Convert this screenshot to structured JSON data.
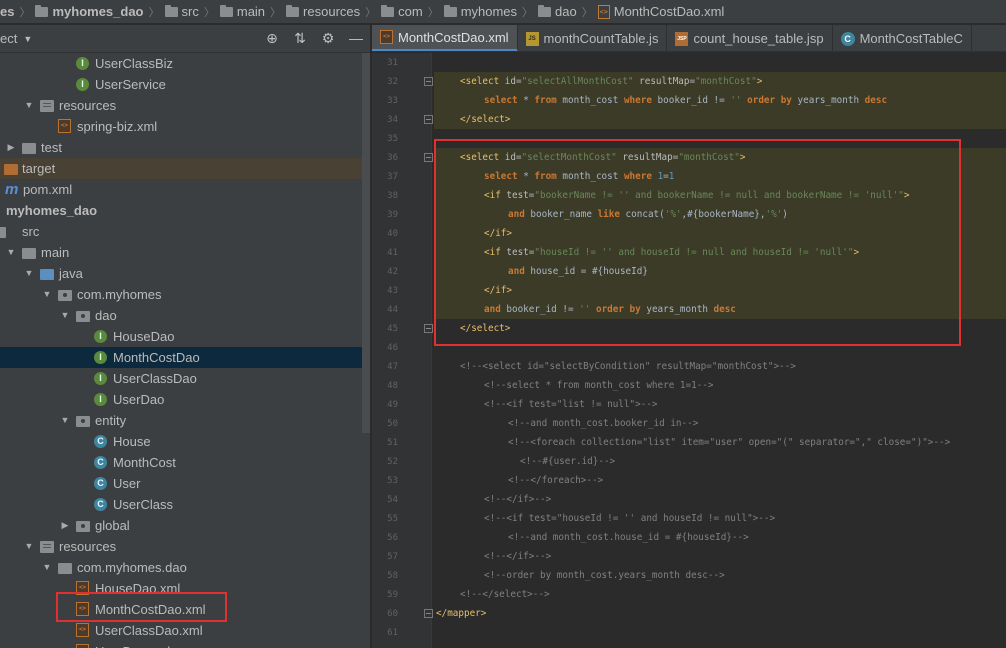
{
  "breadcrumb": [
    "es",
    "myhomes_dao",
    "src",
    "main",
    "resources",
    "com",
    "myhomes",
    "dao",
    "MonthCostDao.xml"
  ],
  "project_panel": {
    "title": "ect",
    "tree": [
      {
        "label": "UserClassBiz",
        "icon": "interface-icon",
        "depth": 4
      },
      {
        "label": "UserService",
        "icon": "interface-icon",
        "depth": 4
      },
      {
        "label": "resources",
        "icon": "resources-folder-icon",
        "depth": 2,
        "arrow": "down"
      },
      {
        "label": "spring-biz.xml",
        "icon": "xml-file-icon",
        "depth": 3
      },
      {
        "label": "test",
        "icon": "folder-icon",
        "depth": 1,
        "arrow": "right"
      },
      {
        "label": "target",
        "icon": "folder-orange-icon",
        "depth": 0,
        "arrow": "",
        "highlight": "target"
      },
      {
        "label": "pom.xml",
        "icon": "maven-icon",
        "depth": 0
      },
      {
        "label": "myhomes_dao",
        "icon": "",
        "depth": 0,
        "bold": true
      },
      {
        "label": "src",
        "icon": "folder-icon",
        "depth": 0
      },
      {
        "label": "main",
        "icon": "folder-icon",
        "depth": 1,
        "arrow": "down"
      },
      {
        "label": "java",
        "icon": "folder-blue-icon",
        "depth": 2,
        "arrow": "down"
      },
      {
        "label": "com.myhomes",
        "icon": "package-icon",
        "depth": 3,
        "arrow": "down"
      },
      {
        "label": "dao",
        "icon": "package-icon",
        "depth": 4,
        "arrow": "down"
      },
      {
        "label": "HouseDao",
        "icon": "interface-icon",
        "depth": 5
      },
      {
        "label": "MonthCostDao",
        "icon": "interface-icon",
        "depth": 5,
        "selected": true
      },
      {
        "label": "UserClassDao",
        "icon": "interface-icon",
        "depth": 5
      },
      {
        "label": "UserDao",
        "icon": "interface-icon",
        "depth": 5
      },
      {
        "label": "entity",
        "icon": "package-icon",
        "depth": 4,
        "arrow": "down"
      },
      {
        "label": "House",
        "icon": "class-icon",
        "depth": 5
      },
      {
        "label": "MonthCost",
        "icon": "class-icon",
        "depth": 5
      },
      {
        "label": "User",
        "icon": "class-icon",
        "depth": 5
      },
      {
        "label": "UserClass",
        "icon": "class-icon",
        "depth": 5
      },
      {
        "label": "global",
        "icon": "package-icon",
        "depth": 4,
        "arrow": "right"
      },
      {
        "label": "resources",
        "icon": "resources-folder-icon",
        "depth": 2,
        "arrow": "down"
      },
      {
        "label": "com.myhomes.dao",
        "icon": "folder-icon",
        "depth": 3,
        "arrow": "down"
      },
      {
        "label": "HouseDao.xml",
        "icon": "xml-file-icon",
        "depth": 4
      },
      {
        "label": "MonthCostDao.xml",
        "icon": "xml-file-icon",
        "depth": 4,
        "boxed": true
      },
      {
        "label": "UserClassDao.xml",
        "icon": "xml-file-icon",
        "depth": 4
      },
      {
        "label": "UserDao.xml",
        "icon": "xml-file-icon",
        "depth": 4
      }
    ]
  },
  "tabs": [
    {
      "label": "MonthCostDao.xml",
      "icon": "xml",
      "active": true
    },
    {
      "label": "monthCountTable.js",
      "icon": "js"
    },
    {
      "label": "count_house_table.jsp",
      "icon": "jsp"
    },
    {
      "label": "MonthCostTableC",
      "icon": "class"
    }
  ],
  "editor": {
    "lines": [
      {
        "n": "31",
        "segs": []
      },
      {
        "n": "32",
        "indent": 2,
        "segs": [
          [
            "t",
            "<select "
          ],
          [
            "an",
            "id="
          ],
          [
            "av",
            "\"selectAllMonthCost\" "
          ],
          [
            "an",
            "resultMap="
          ],
          [
            "av",
            "\"monthCost\""
          ],
          [
            "t",
            ">"
          ]
        ]
      },
      {
        "n": "33",
        "indent": 4,
        "segs": [
          [
            "kw",
            "select"
          ],
          [
            "pl",
            " * "
          ],
          [
            "kw",
            "from"
          ],
          [
            "pl",
            " month_cost "
          ],
          [
            "kw",
            "where"
          ],
          [
            "pl",
            " booker_id != "
          ],
          [
            "str",
            "'' "
          ],
          [
            "kw",
            "order by"
          ],
          [
            "pl",
            " years_month "
          ],
          [
            "kw",
            "desc"
          ]
        ]
      },
      {
        "n": "34",
        "indent": 2,
        "segs": [
          [
            "t",
            "</select>"
          ]
        ]
      },
      {
        "n": "35",
        "segs": []
      },
      {
        "n": "36",
        "indent": 2,
        "segs": [
          [
            "t",
            "<select "
          ],
          [
            "an",
            "id="
          ],
          [
            "av",
            "\"selectMonthCost\" "
          ],
          [
            "an",
            "resultMap="
          ],
          [
            "av",
            "\"monthCost\""
          ],
          [
            "t",
            ">"
          ]
        ]
      },
      {
        "n": "37",
        "indent": 4,
        "segs": [
          [
            "kw",
            "select"
          ],
          [
            "pl",
            " * "
          ],
          [
            "kw",
            "from"
          ],
          [
            "pl",
            " month_cost "
          ],
          [
            "kw",
            "where"
          ],
          [
            "pl",
            " "
          ],
          [
            "num",
            "1"
          ],
          [
            "pl",
            "="
          ],
          [
            "num",
            "1"
          ]
        ]
      },
      {
        "n": "38",
        "indent": 4,
        "segs": [
          [
            "t",
            "<if "
          ],
          [
            "an",
            "test="
          ],
          [
            "av",
            "\"bookerName != '' and bookerName != null and bookerName != 'null'\""
          ],
          [
            "t",
            ">"
          ]
        ]
      },
      {
        "n": "39",
        "indent": 6,
        "segs": [
          [
            "kw",
            "and"
          ],
          [
            "pl",
            " booker_name "
          ],
          [
            "kw",
            "like"
          ],
          [
            "pl",
            " concat("
          ],
          [
            "str",
            "'%'"
          ],
          [
            "pl",
            ",#{bookerName},"
          ],
          [
            "str",
            "'%'"
          ],
          [
            "pl",
            ")"
          ]
        ]
      },
      {
        "n": "40",
        "indent": 4,
        "segs": [
          [
            "t",
            "</if>"
          ]
        ]
      },
      {
        "n": "41",
        "indent": 4,
        "segs": [
          [
            "t",
            "<if "
          ],
          [
            "an",
            "test="
          ],
          [
            "av",
            "\"houseId != '' and houseId != null and houseId != 'null'\""
          ],
          [
            "t",
            ">"
          ]
        ]
      },
      {
        "n": "42",
        "indent": 6,
        "segs": [
          [
            "kw",
            "and"
          ],
          [
            "pl",
            " house_id = #{houseId}"
          ]
        ]
      },
      {
        "n": "43",
        "indent": 4,
        "segs": [
          [
            "t",
            "</if>"
          ]
        ]
      },
      {
        "n": "44",
        "indent": 4,
        "segs": [
          [
            "kw",
            "and"
          ],
          [
            "pl",
            " booker_id != "
          ],
          [
            "str",
            "'' "
          ],
          [
            "kw",
            "order by"
          ],
          [
            "pl",
            " years_month "
          ],
          [
            "kw",
            "desc"
          ]
        ]
      },
      {
        "n": "45",
        "indent": 2,
        "segs": [
          [
            "t",
            "</select>"
          ]
        ]
      },
      {
        "n": "46",
        "segs": []
      },
      {
        "n": "47",
        "indent": 2,
        "segs": [
          [
            "cm",
            "<!--<select id=\"selectByCondition\" resultMap=\"monthCost\">-->"
          ]
        ]
      },
      {
        "n": "48",
        "indent": 4,
        "segs": [
          [
            "cm",
            "<!--select * from month_cost where 1=1-->"
          ]
        ]
      },
      {
        "n": "49",
        "indent": 4,
        "segs": [
          [
            "cm",
            "<!--<if test=\"list != null\">-->"
          ]
        ]
      },
      {
        "n": "50",
        "indent": 6,
        "segs": [
          [
            "cm",
            "<!--and month_cost.booker_id in-->"
          ]
        ]
      },
      {
        "n": "51",
        "indent": 6,
        "segs": [
          [
            "cm",
            "<!--<foreach collection=\"list\" item=\"user\" open=\"(\" separator=\",\" close=\")\">-->"
          ]
        ]
      },
      {
        "n": "52",
        "indent": 7,
        "segs": [
          [
            "cm",
            "<!--#{user.id}-->"
          ]
        ]
      },
      {
        "n": "53",
        "indent": 6,
        "segs": [
          [
            "cm",
            "<!--</foreach>-->"
          ]
        ]
      },
      {
        "n": "54",
        "indent": 4,
        "segs": [
          [
            "cm",
            "<!--</if>-->"
          ]
        ]
      },
      {
        "n": "55",
        "indent": 4,
        "segs": [
          [
            "cm",
            "<!--<if test=\"houseId != '' and houseId != null\">-->"
          ]
        ]
      },
      {
        "n": "56",
        "indent": 6,
        "segs": [
          [
            "cm",
            "<!--and month_cost.house_id = #{houseId}-->"
          ]
        ]
      },
      {
        "n": "57",
        "indent": 4,
        "segs": [
          [
            "cm",
            "<!--</if>-->"
          ]
        ]
      },
      {
        "n": "58",
        "indent": 4,
        "segs": [
          [
            "cm",
            "<!--order by month_cost.years_month desc-->"
          ]
        ]
      },
      {
        "n": "59",
        "indent": 2,
        "segs": [
          [
            "cm",
            "<!--</select>-->"
          ]
        ]
      },
      {
        "n": "60",
        "indent": 0,
        "segs": [
          [
            "t",
            "</mapper>"
          ]
        ]
      },
      {
        "n": "61",
        "segs": []
      }
    ]
  },
  "colors": {
    "accent": "#4a88c7",
    "annotation_box": "#e03030",
    "selection": "#0d293e"
  }
}
